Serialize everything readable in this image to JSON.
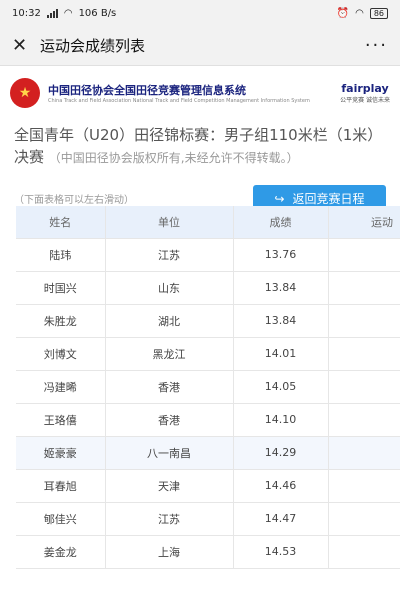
{
  "status": {
    "time": "10:32",
    "speed": "106 B/s",
    "battery": "86"
  },
  "window": {
    "title": "运动会成绩列表"
  },
  "banner": {
    "title_cn": "中国田径协会全国田径竞赛管理信息系统",
    "title_en": "China Track and Field Association National Track and Field Competition Management Information System",
    "brand": "fairplay",
    "brand_sub": "公平竞赛  诚信未来"
  },
  "heading": {
    "title": "全国青年（U20）田径锦标赛：男子组110米栏（1米）决赛",
    "note": "（中国田径协会版权所有,未经允许不得转载。）"
  },
  "hint": "（下面表格可以左右滑动）",
  "back_button": "返回竞赛日程",
  "table": {
    "headers": [
      "姓名",
      "单位",
      "成绩",
      "运动"
    ],
    "rows": [
      {
        "name": "陆玮",
        "unit": "江苏",
        "score": "13.76"
      },
      {
        "name": "时国兴",
        "unit": "山东",
        "score": "13.84"
      },
      {
        "name": "朱胜龙",
        "unit": "湖北",
        "score": "13.84"
      },
      {
        "name": "刘博文",
        "unit": "黑龙江",
        "score": "14.01"
      },
      {
        "name": "冯建晞",
        "unit": "香港",
        "score": "14.05"
      },
      {
        "name": "王珞僖",
        "unit": "香港",
        "score": "14.10"
      },
      {
        "name": "姬豪豪",
        "unit": "八一南昌",
        "score": "14.29"
      },
      {
        "name": "耳春旭",
        "unit": "天津",
        "score": "14.46"
      },
      {
        "name": "郇佳兴",
        "unit": "江苏",
        "score": "14.47"
      },
      {
        "name": "姜金龙",
        "unit": "上海",
        "score": "14.53"
      }
    ]
  }
}
